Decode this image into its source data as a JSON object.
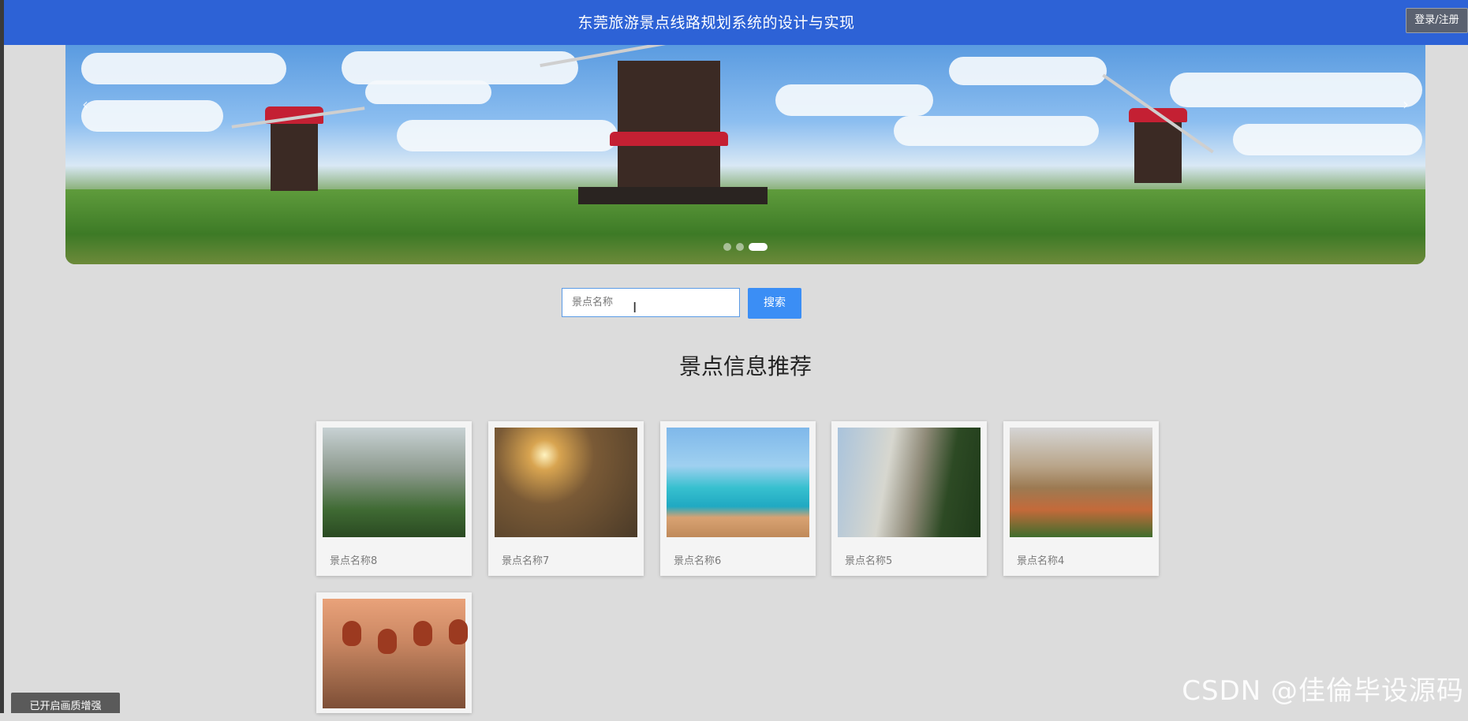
{
  "header": {
    "title": "东莞旅游景点线路规划系统的设计与实现",
    "login_label": "登录/注册"
  },
  "carousel": {
    "prev_symbol": "‹",
    "next_symbol": "›",
    "slide_count": 3,
    "active_index": 2
  },
  "search": {
    "placeholder": "景点名称",
    "button_label": "搜索"
  },
  "section": {
    "title": "景点信息推荐"
  },
  "spots": [
    {
      "name": "景点名称8"
    },
    {
      "name": "景点名称7"
    },
    {
      "name": "景点名称6"
    },
    {
      "name": "景点名称5"
    },
    {
      "name": "景点名称4"
    },
    {
      "name": ""
    }
  ],
  "watermark": "CSDN @佳倫毕设源码",
  "toast": "已开启画质增强",
  "colors": {
    "header_bg": "#2d62d6",
    "search_button": "#3b8ef5",
    "page_bg": "#dcdcdc"
  }
}
